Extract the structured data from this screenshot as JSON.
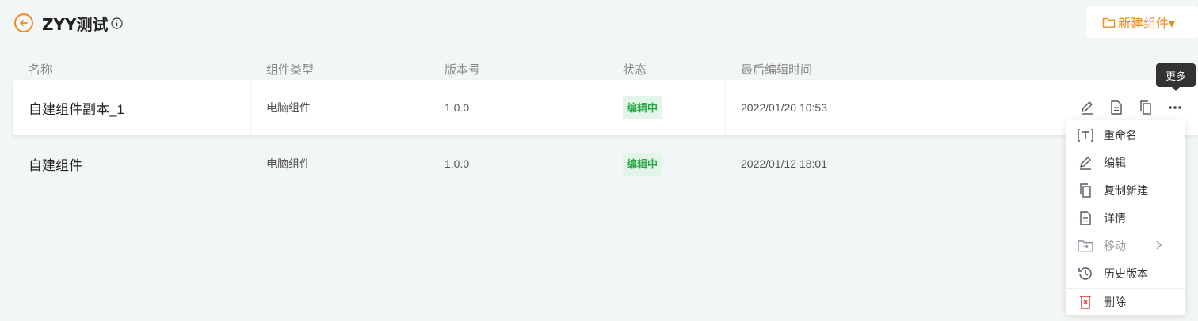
{
  "header": {
    "title": "ZYY测试",
    "new_button": "新建组件▾"
  },
  "table": {
    "columns": [
      "名称",
      "组件类型",
      "版本号",
      "状态",
      "最后编辑时间"
    ],
    "rows": [
      {
        "name": "自建组件副本_1",
        "type": "电脑组件",
        "version": "1.0.0",
        "status": "编辑中",
        "time": "2022/01/20 10:53"
      },
      {
        "name": "自建组件",
        "type": "电脑组件",
        "version": "1.0.0",
        "status": "编辑中",
        "time": "2022/01/12 18:01"
      }
    ]
  },
  "tooltip": "更多",
  "menu": {
    "items": [
      "重命名",
      "编辑",
      "复制新建",
      "详情",
      "移动",
      "历史版本",
      "删除"
    ]
  },
  "colors": {
    "accent": "#f28a1e",
    "status_bg": "#e3f5e8",
    "status_text": "#27a845",
    "danger": "#e53935"
  }
}
